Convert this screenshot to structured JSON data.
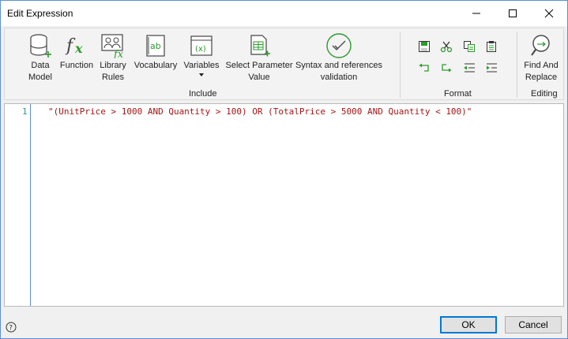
{
  "window": {
    "title": "Edit Expression"
  },
  "ribbon": {
    "groups": {
      "include": "Include",
      "format": "Format",
      "editing": "Editing"
    },
    "buttons": {
      "data_model": "Data Model",
      "function": "Function",
      "library_rules": "Library Rules",
      "vocabulary": "Vocabulary",
      "variables": "Variables",
      "select_parameter_value": "Select Parameter Value",
      "syntax_validation": "Syntax and references validation",
      "find_replace": "Find And Replace"
    }
  },
  "editor": {
    "line_number": "1",
    "expression": "\"(UnitPrice > 1000 AND Quantity > 100) OR (TotalPrice > 5000 AND Quantity < 100)\""
  },
  "footer": {
    "ok": "OK",
    "cancel": "Cancel"
  },
  "colors": {
    "accent": "#0078d7",
    "string": "#a31515",
    "line_number": "#2b91af"
  }
}
